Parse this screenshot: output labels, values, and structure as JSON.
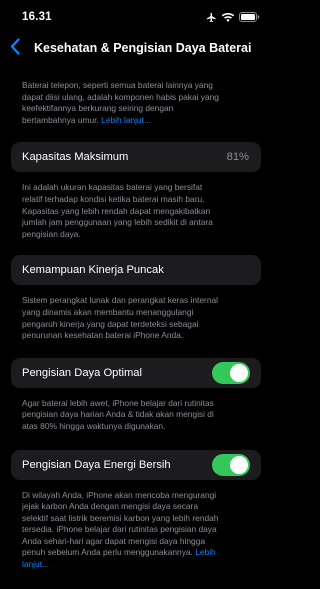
{
  "status_bar": {
    "time": "16.31",
    "icons": [
      "airplane-icon",
      "wifi-icon",
      "battery-icon"
    ]
  },
  "nav": {
    "back_icon": "chevron-left-icon",
    "title": "Kesehatan & Pengisian Daya Baterai"
  },
  "intro": {
    "lines": [
      "Baterai telepon, seperti semua baterai lainnya yang",
      "dapat diisi ulang, adalah komponen habis pakai yang",
      "keefektifannya berkurang seiring dengan",
      "bertambahnya umur."
    ],
    "link": "Lebih lanjut..."
  },
  "max_capacity": {
    "label": "Kapasitas Maksimum",
    "value": "81%",
    "desc_lines": [
      "Ini adalah ukuran kapasitas baterai yang bersifat",
      "relatif terhadap kondisi ketika baterai masih baru.",
      "Kapasitas yang lebih rendah dapat mengakibatkan",
      "jumlah jam penggunaan yang lebih sedikit di antara",
      "pengisian daya."
    ]
  },
  "peak_performance": {
    "label": "Kemampuan Kinerja Puncak",
    "desc_lines": [
      "Sistem perangkat lunak dan perangkat keras internal",
      "yang dinamis akan membantu menanggulangi",
      "pengaruh kinerja yang dapat terdeteksi sebagai",
      "penurunan kesehatan baterai iPhone Anda."
    ]
  },
  "optimized_charging": {
    "label": "Pengisian Daya Optimal",
    "enabled": true,
    "desc_lines": [
      "Agar baterai lebih awet, iPhone belajar dari rutinitas",
      "pengisian daya harian Anda & tidak akan mengisi di",
      "atas 80% hingga waktunya digunakan."
    ]
  },
  "clean_energy": {
    "label": "Pengisian Daya Energi Bersih",
    "enabled": true,
    "desc_lines": [
      "Di wilayah Anda, iPhone akan mencoba mengurangi",
      "jejak karbon Anda dengan mengisi daya secara",
      "selektif saat listrik beremisi karbon yang lebih rendah",
      "tersedia. iPhone belajar dari rutinitas pengisian daya",
      "Anda sehari-hari agar dapat mengisi daya hingga",
      "penuh sebelum Anda perlu menggunakannya."
    ],
    "link_part1": "Lebih",
    "link_part2": "lanjut..."
  },
  "colors": {
    "background": "#000000",
    "cell": "#1c1c1e",
    "secondary_text": "#8e8e93",
    "accent": "#0a84ff",
    "toggle_on": "#34c759"
  }
}
